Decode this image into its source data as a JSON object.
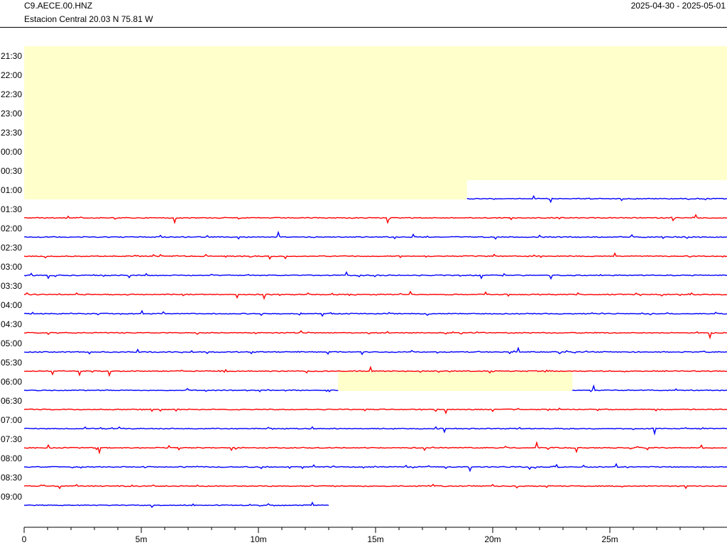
{
  "header": {
    "station_code": "C9.AECE.00.HNZ",
    "station_description": "Estacion Central  20.03 N 75.81 W",
    "date_range": "2025-04-30 - 2025-05-01"
  },
  "colors": {
    "trace_red": "#ff0000",
    "trace_blue": "#0000ff",
    "gap_fill": "#ffffcc",
    "axis": "#000000"
  },
  "chart_data": {
    "type": "line",
    "title": "",
    "xlabel": "",
    "ylabel": "",
    "x_ticks": [
      "0",
      "5m",
      "10m",
      "15m",
      "20m",
      "25m"
    ],
    "x_tick_values_minutes": [
      0,
      5,
      10,
      15,
      20,
      25
    ],
    "x_range_minutes": [
      0,
      30
    ],
    "row_labels": [
      "21:30",
      "22:00",
      "22:30",
      "23:00",
      "23:30",
      "00:00",
      "00:30",
      "01:00",
      "01:30",
      "02:00",
      "02:30",
      "03:00",
      "03:30",
      "04:00",
      "04:30",
      "05:00",
      "05:30",
      "06:00",
      "06:30",
      "07:00",
      "07:30",
      "08:00",
      "08:30",
      "09:00"
    ],
    "rows": [
      {
        "start": "21:30",
        "color": "red",
        "data": false
      },
      {
        "start": "22:00",
        "color": "blue",
        "data": false
      },
      {
        "start": "22:30",
        "color": "red",
        "data": false
      },
      {
        "start": "23:00",
        "color": "blue",
        "data": false
      },
      {
        "start": "23:30",
        "color": "red",
        "data": false
      },
      {
        "start": "00:00",
        "color": "blue",
        "data": false
      },
      {
        "start": "00:30",
        "color": "red",
        "data": false
      },
      {
        "start": "01:00",
        "color": "blue",
        "data_from_min": 18.9,
        "data_to_min": 30
      },
      {
        "start": "01:30",
        "color": "red",
        "data_from_min": 0,
        "data_to_min": 30
      },
      {
        "start": "02:00",
        "color": "blue",
        "data_from_min": 0,
        "data_to_min": 30
      },
      {
        "start": "02:30",
        "color": "red",
        "data_from_min": 0,
        "data_to_min": 30
      },
      {
        "start": "03:00",
        "color": "blue",
        "data_from_min": 0,
        "data_to_min": 30
      },
      {
        "start": "03:30",
        "color": "red",
        "data_from_min": 0,
        "data_to_min": 30
      },
      {
        "start": "04:00",
        "color": "blue",
        "data_from_min": 0,
        "data_to_min": 30
      },
      {
        "start": "04:30",
        "color": "red",
        "data_from_min": 0,
        "data_to_min": 30
      },
      {
        "start": "05:00",
        "color": "blue",
        "data_from_min": 0,
        "data_to_min": 30
      },
      {
        "start": "05:30",
        "color": "red",
        "data_from_min": 0,
        "data_to_min": 30
      },
      {
        "start": "06:00",
        "color": "blue",
        "segments_min": [
          [
            0,
            13.4
          ],
          [
            23.4,
            30
          ]
        ],
        "gap_min": [
          13.4,
          23.4
        ]
      },
      {
        "start": "06:30",
        "color": "red",
        "data_from_min": 0,
        "data_to_min": 30
      },
      {
        "start": "07:00",
        "color": "blue",
        "data_from_min": 0,
        "data_to_min": 30
      },
      {
        "start": "07:30",
        "color": "red",
        "data_from_min": 0,
        "data_to_min": 30
      },
      {
        "start": "08:00",
        "color": "blue",
        "data_from_min": 0,
        "data_to_min": 30
      },
      {
        "start": "08:30",
        "color": "red",
        "data_from_min": 0,
        "data_to_min": 30
      },
      {
        "start": "09:00",
        "color": "blue",
        "data_from_min": 0,
        "data_to_min": 13.0
      }
    ]
  }
}
